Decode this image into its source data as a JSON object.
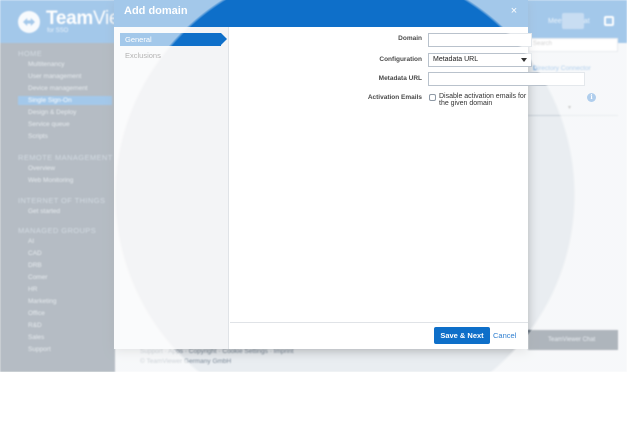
{
  "app": {
    "brand_bold": "Team",
    "brand_light": "Viewer",
    "brand_sub": "for SSO",
    "top_chat": "Meeting Chat",
    "search_placeholder": "Search",
    "directory_link": "Directory Connector",
    "footer_line1": "Support · Apps · Copyright · Cookie Settings · Imprint",
    "footer_line2": "© TeamViewer Germany GmbH",
    "chat_label": "TeamViewer Chat"
  },
  "sidebar": {
    "sections": [
      {
        "title": "HOME",
        "items": [
          "Multitenancy",
          "User management",
          "Device management",
          "Single Sign-On",
          "Design & Deploy",
          "Service queue",
          "Scripts"
        ]
      },
      {
        "title": "REMOTE MANAGEMENT",
        "items": [
          "Overview",
          "Web Monitoring"
        ]
      },
      {
        "title": "INTERNET OF THINGS",
        "items": [
          "Get started"
        ]
      },
      {
        "title": "MANAGED GROUPS",
        "items": [
          "AI",
          "CAD",
          "DRB",
          "Comer",
          "HR",
          "Marketing",
          "Office",
          "R&D",
          "Sales",
          "Support"
        ]
      }
    ],
    "active_item": "Single Sign-On"
  },
  "dialog": {
    "title": "Add domain",
    "close_glyph": "×",
    "nav": [
      "General",
      "Exclusions"
    ],
    "active_nav": "General",
    "fields": {
      "domain_label": "Domain",
      "domain_value": "",
      "configuration_label": "Configuration",
      "configuration_value": "Metadata URL",
      "metadata_url_label": "Metadata URL",
      "metadata_url_value": "",
      "activation_emails_label": "Activation Emails",
      "activation_checkbox_label": "Disable activation emails for the given domain",
      "activation_checked": false,
      "info_glyph": "i"
    },
    "buttons": {
      "save_next": "Save & Next",
      "cancel": "Cancel"
    }
  },
  "colors": {
    "accent": "#0e6fc9",
    "sidebar_bg": "#3c4f63",
    "link": "#2f7fd0"
  }
}
